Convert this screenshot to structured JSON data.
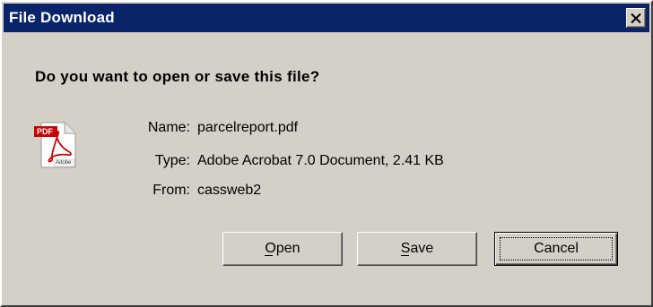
{
  "window": {
    "title": "File Download"
  },
  "dialog": {
    "question": "Do you want to open or save this file?",
    "icon": "pdf-file-icon",
    "file": {
      "name_label": "Name:",
      "name_value": "parcelreport.pdf",
      "type_label": "Type:",
      "type_value": "Adobe Acrobat 7.0 Document, 2.41 KB",
      "from_label": "From:",
      "from_value": "cassweb2"
    },
    "icon_text": {
      "badge": "PDF",
      "footer": "Adobe"
    }
  },
  "buttons": {
    "open": "Open",
    "save": "Save",
    "cancel": "Cancel",
    "default": "cancel"
  },
  "colors": {
    "titlebar": "#0a246a",
    "face": "#d4d0c8",
    "pdf_red": "#cc0000"
  }
}
